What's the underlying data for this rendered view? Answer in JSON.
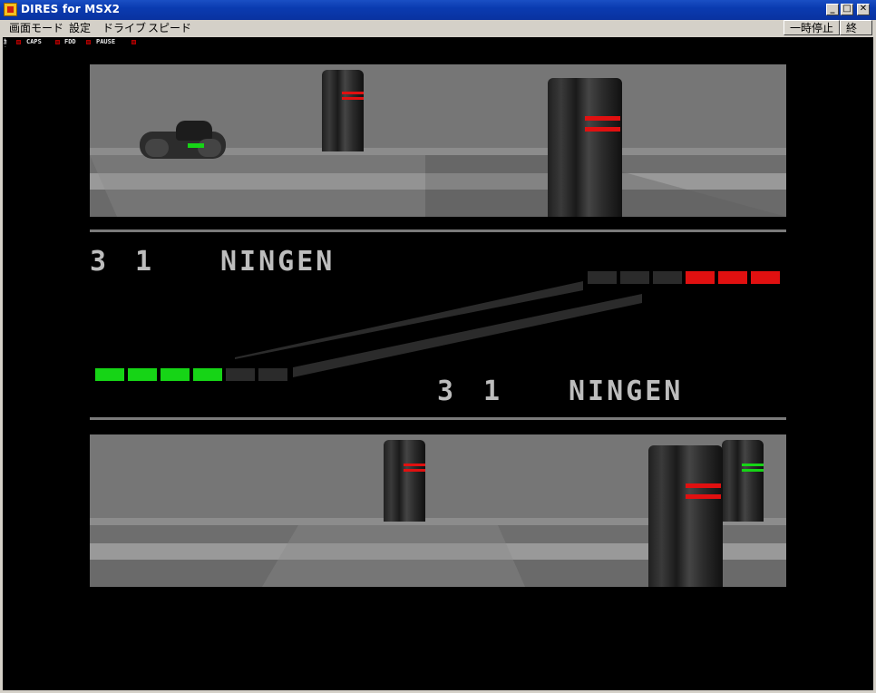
{
  "window": {
    "title": "DIRES for MSX2",
    "min_symbol": "_",
    "max_symbol": "□",
    "close_symbol": "✕"
  },
  "menu": {
    "items": [
      "画面モード",
      "設定",
      "ドライブ",
      "スピード"
    ],
    "pause_button": "一時停止",
    "exit_button": "終了"
  },
  "status": {
    "kana_label": "ｶﾅ",
    "caps_label": "CAPS",
    "fdd_label": "FDD",
    "pause_label": "PAUSE",
    "led_color": "#b00000"
  },
  "hud": {
    "player1": {
      "score_a": "3",
      "score_b": "1",
      "name": "NINGEN"
    },
    "player2": {
      "score_a": "3",
      "score_b": "1",
      "name": "NINGEN"
    },
    "colors": {
      "green": "#16d416",
      "red": "#e01010",
      "dark": "#2b2b2b"
    }
  }
}
